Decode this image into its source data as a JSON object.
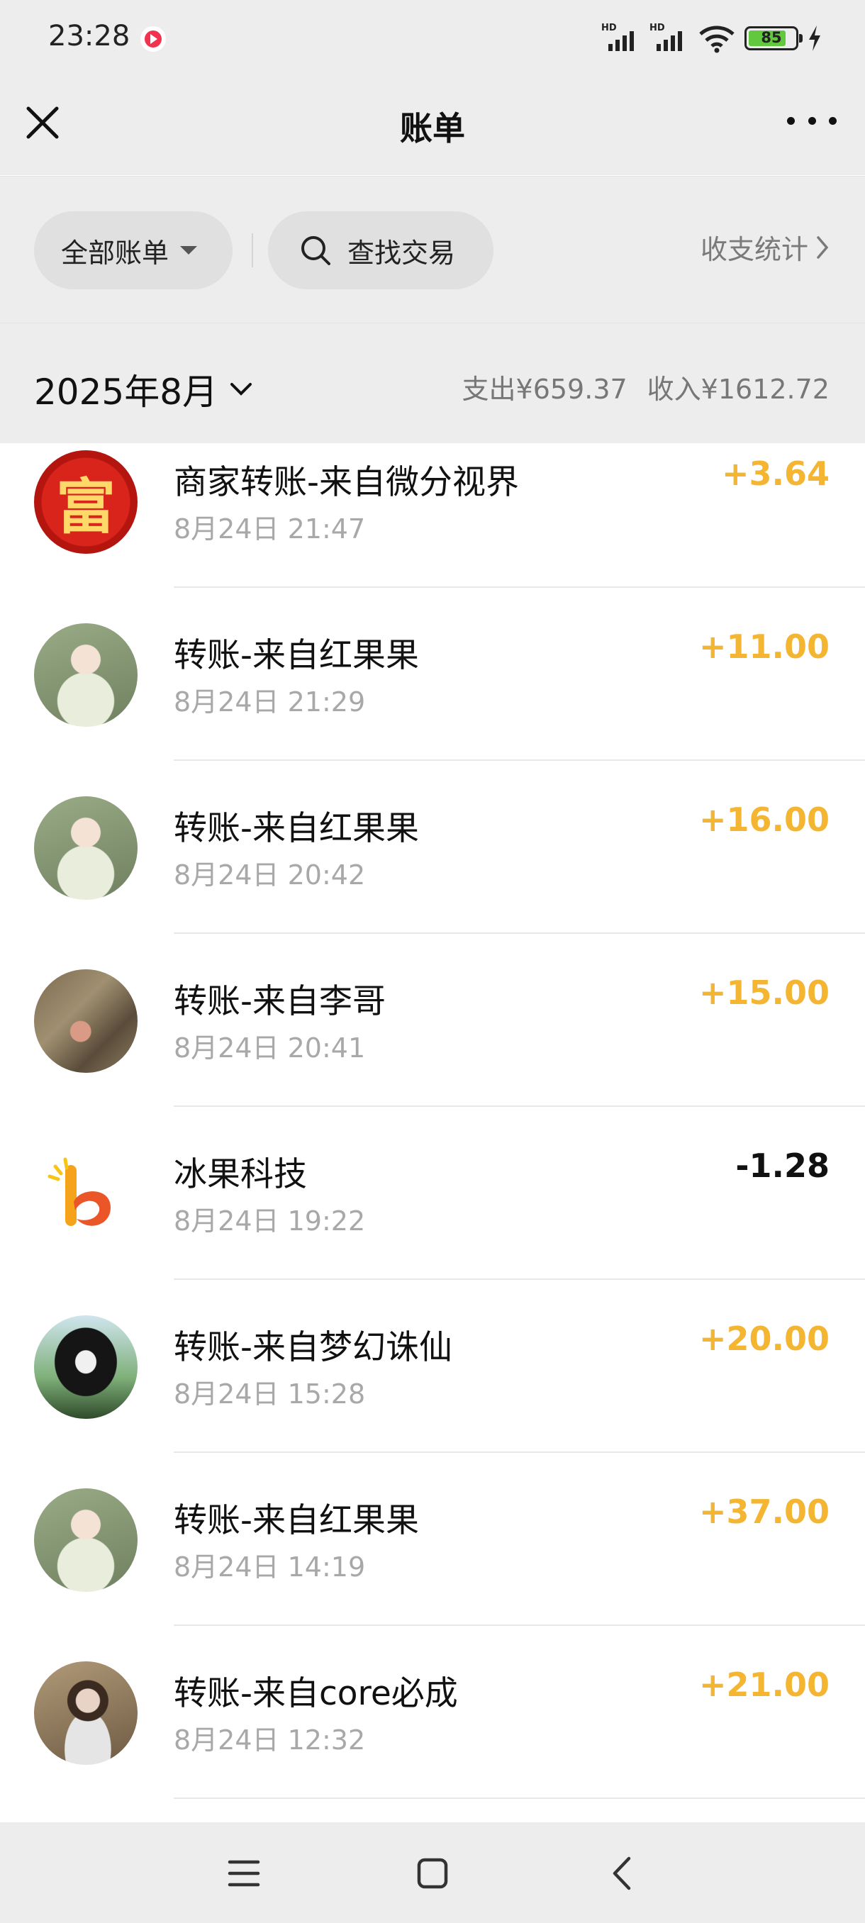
{
  "status_bar": {
    "time": "23:28",
    "battery_level": "85",
    "icons": [
      "record-icon",
      "signal-hd-icon",
      "signal-hd-icon",
      "wifi-icon",
      "battery-icon",
      "charging-icon"
    ]
  },
  "nav": {
    "title": "账单",
    "close_icon": "close-icon",
    "more_icon": "more-icon"
  },
  "filters": {
    "all_bills_label": "全部账单",
    "search_label": "查找交易",
    "stats_label": "收支统计"
  },
  "month": {
    "label": "2025年8月",
    "expense": "支出¥659.37",
    "income": "收入¥1612.72"
  },
  "transactions": [
    {
      "title": "商家转账-来自微分视界",
      "time": "8月24日 21:47",
      "amount": "+3.64",
      "avatar": "fu-avatar"
    },
    {
      "title": "转账-来自红果果",
      "time": "8月24日 21:29",
      "amount": "+11.00",
      "avatar": "girl-avatar"
    },
    {
      "title": "转账-来自红果果",
      "time": "8月24日 20:42",
      "amount": "+16.00",
      "avatar": "girl-avatar"
    },
    {
      "title": "转账-来自李哥",
      "time": "8月24日 20:41",
      "amount": "+15.00",
      "avatar": "bird-avatar"
    },
    {
      "title": "冰果科技",
      "time": "8月24日 19:22",
      "amount": "-1.28",
      "avatar": "bingguo-logo"
    },
    {
      "title": "转账-来自梦幻诛仙",
      "time": "8月24日 15:28",
      "amount": "+20.00",
      "avatar": "longhair-avatar"
    },
    {
      "title": "转账-来自红果果",
      "time": "8月24日 14:19",
      "amount": "+37.00",
      "avatar": "girl-avatar"
    },
    {
      "title": "转账-来自core必成",
      "time": "8月24日 12:32",
      "amount": "+21.00",
      "avatar": "photo-avatar"
    }
  ],
  "avatar_glyphs": {
    "fu": "富"
  },
  "colors": {
    "income": "#f3b532",
    "expense": "#111111",
    "background": "#ededed"
  }
}
